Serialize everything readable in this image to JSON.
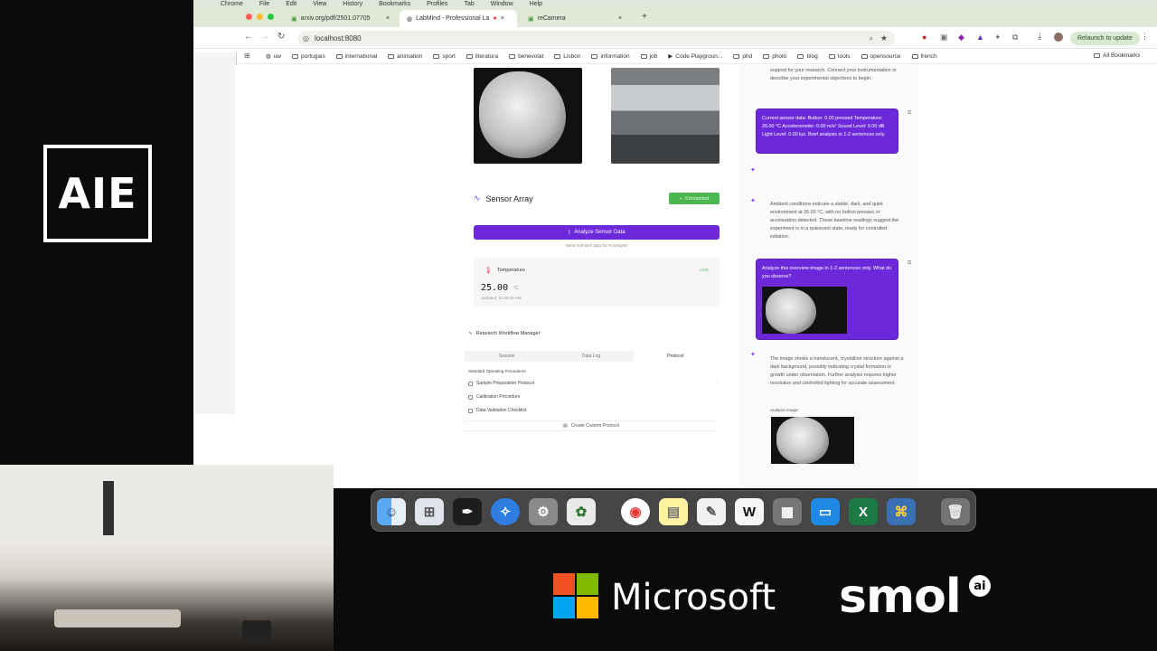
{
  "overlay": {
    "logo_text": "AIE"
  },
  "browser": {
    "menu": [
      "Chrome",
      "File",
      "Edit",
      "View",
      "History",
      "Bookmarks",
      "Profiles",
      "Tab",
      "Window",
      "Help"
    ],
    "tabs": [
      {
        "label": "arxiv.org/pdf/2501.07705"
      },
      {
        "label": "LabMind - Professional La"
      },
      {
        "label": "reCamera"
      }
    ],
    "url": "localhost:8080",
    "relaunch_label": "Relaunch to update",
    "bookmarks": [
      "uw",
      "portugais",
      "international",
      "animation",
      "sport",
      "literatura",
      "benevolat",
      "Lisbon",
      "information",
      "job",
      "Code Playgroun...",
      "phd",
      "photo",
      "blog",
      "tools",
      "opensource",
      "french"
    ],
    "all_bookmarks": "All Bookmarks"
  },
  "sensor": {
    "title": "Sensor Array",
    "status": "Connected",
    "analyze_button": "Analyze Sensor Data",
    "hint": "Send real-time data for AI analysis",
    "reading": {
      "name": "Temperature",
      "badge": "LIVE",
      "value": "25.00",
      "unit": "°C",
      "updated": "Updated: 11:38:16 AM"
    }
  },
  "workflow": {
    "title": "Research Workflow Manager",
    "tabs": [
      "Session",
      "Data Log",
      "Protocol"
    ],
    "section": "Standard Operating Procedures:",
    "items": [
      "Sample Preparation Protocol",
      "Calibration Procedure",
      "Data Validation Checklist"
    ],
    "create_button": "Create Custom Protocol"
  },
  "chat": {
    "intro": "support for your research. Connect your instrumentation or describe your experimental objectives to begin.",
    "user1": "Current sensor data: Button: 0.00 pressed Temperature: 26.00 °C Accelerometer: 0.00 m/s² Sound Level: 0.00 dB Light Level: 0.00 lux. Brief analysis in 1-2 sentences only.",
    "ai1": "Ambient conditions indicate a stable, dark, and quiet environment at 26.00 °C, with no button presses or acceleration detected. These baseline readings suggest the experiment is in a quiescent state, ready for controlled initiation.",
    "user2": "Analyze this overview image in 1-2 sentences only. What do you observe?",
    "ai2": "The image shows a translucent, crystalline structure against a dark background, possibly indicating crystal formation or growth under observation. Further analysis requires higher resolution and controlled lighting for accurate assessment.",
    "analysis_label": "Analysis Image:"
  },
  "sponsors": {
    "microsoft": "Microsoft",
    "smol": "smol",
    "smol_badge": "ai"
  },
  "colors": {
    "accent_purple": "#6d28d9",
    "connected_green": "#4cb74f"
  }
}
